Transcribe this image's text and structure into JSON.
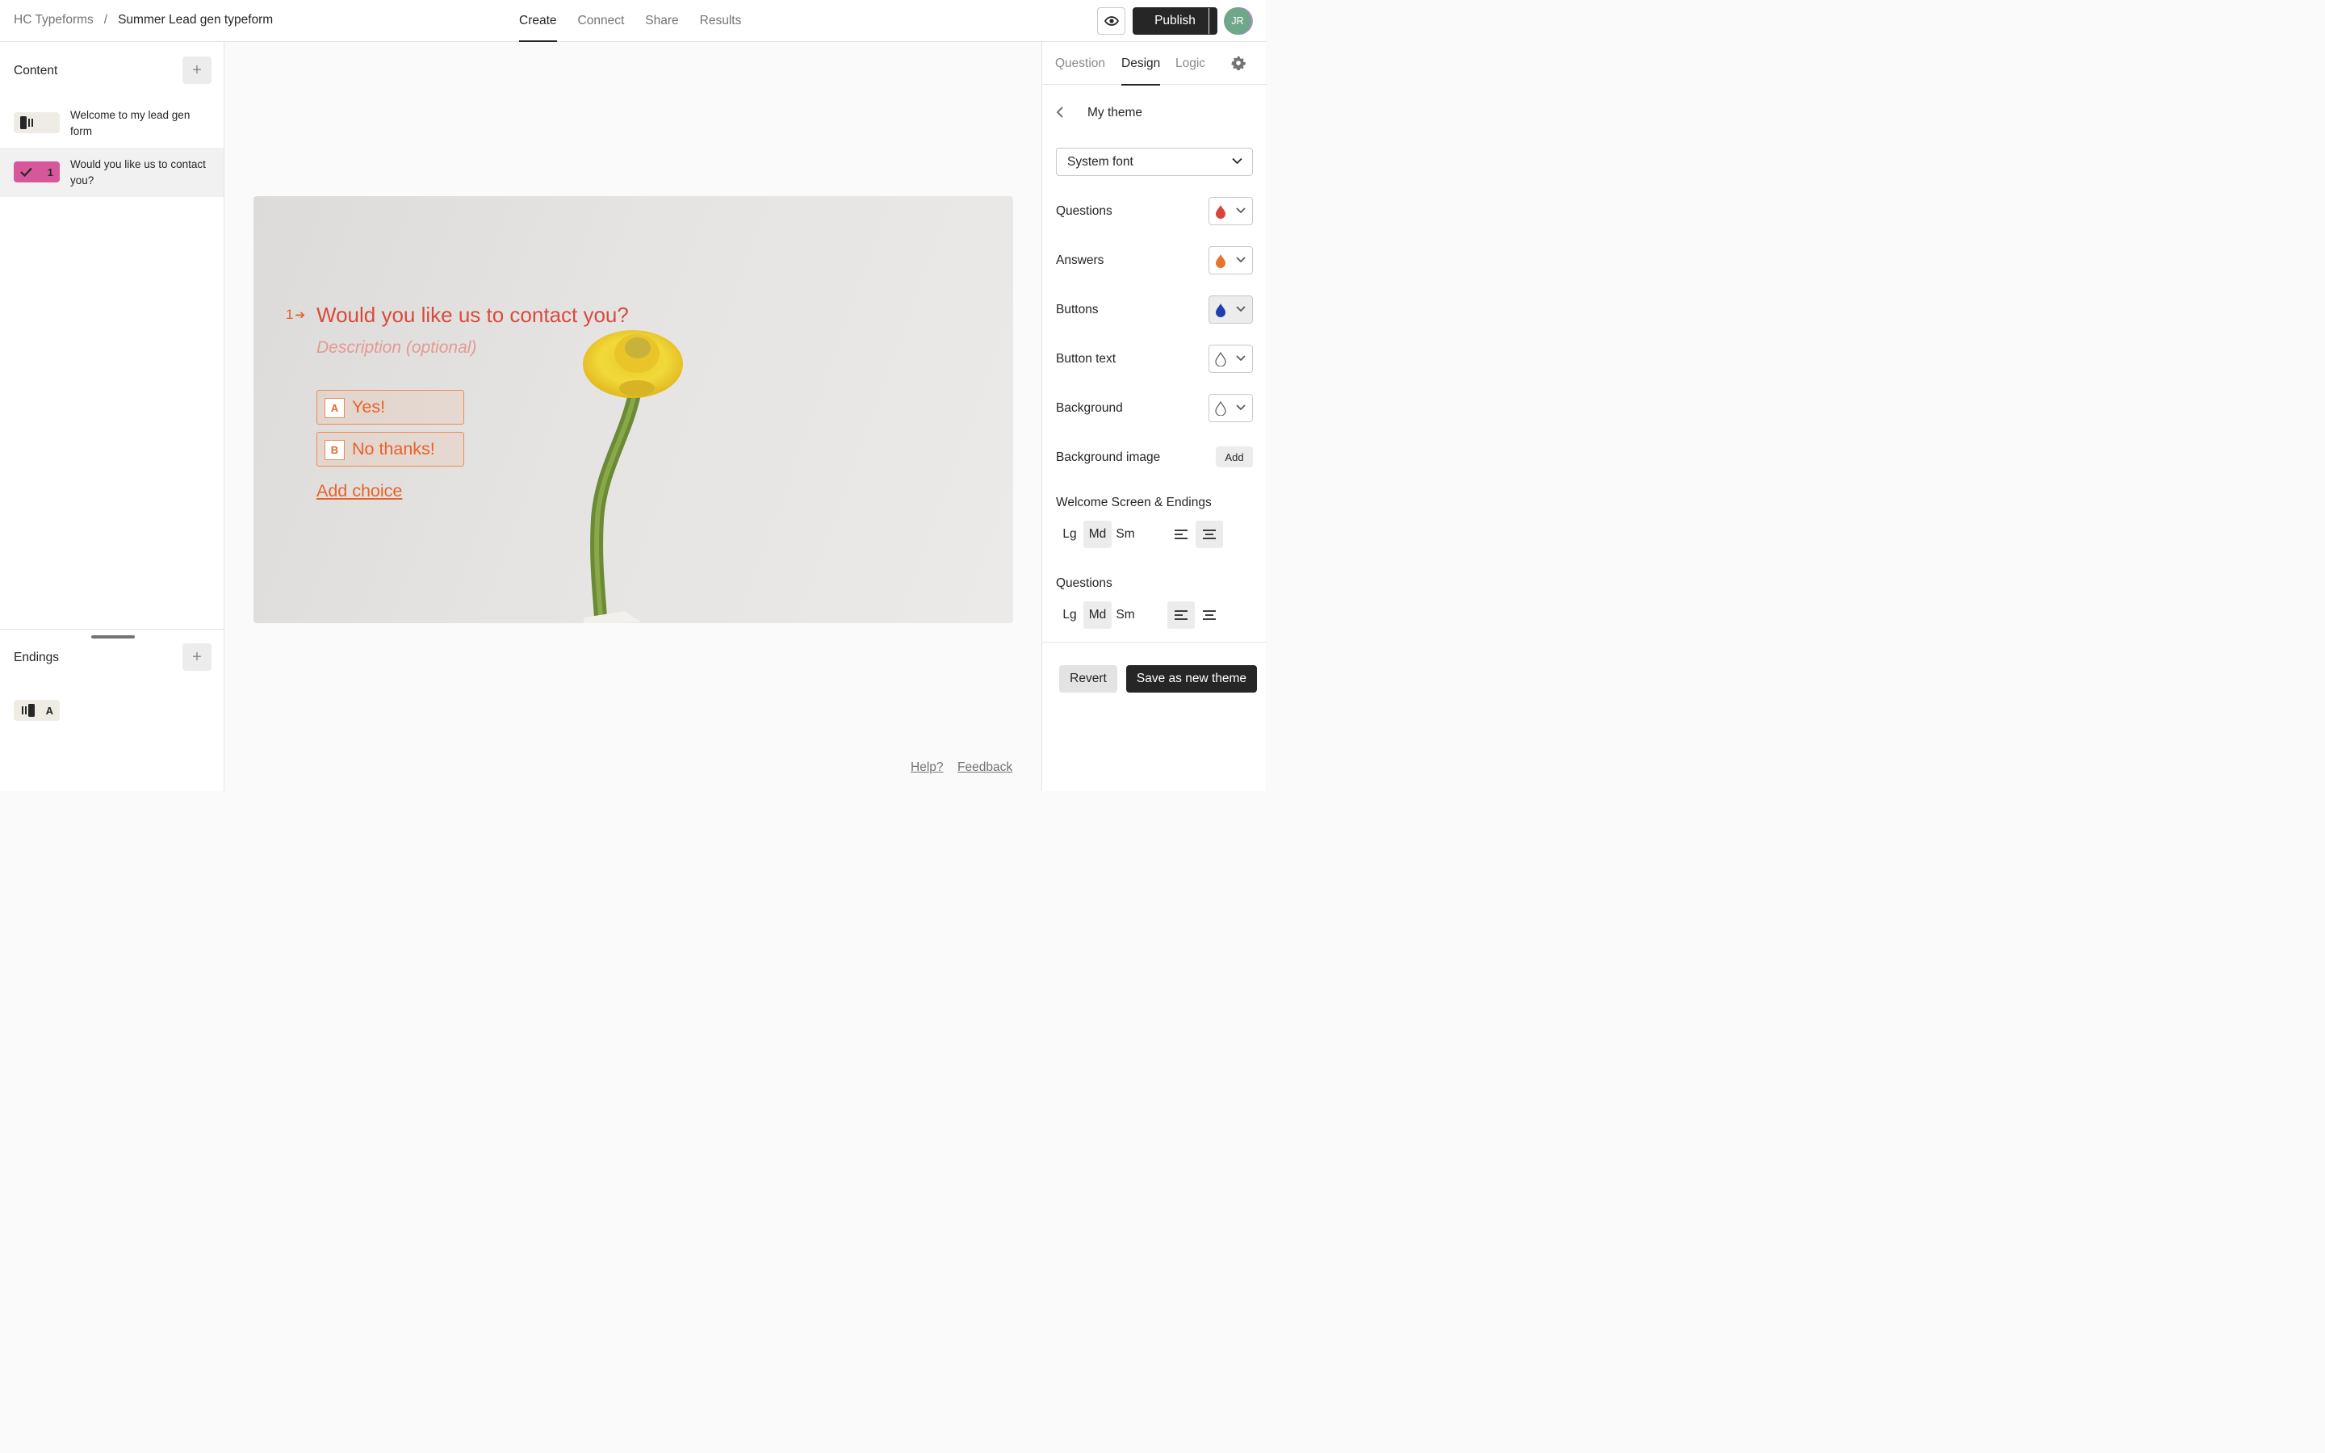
{
  "breadcrumb": {
    "workspace": "HC Typeforms",
    "separator": "/",
    "form": "Summer Lead gen typeform"
  },
  "main_tabs": [
    {
      "label": "Create",
      "active": true
    },
    {
      "label": "Connect",
      "active": false
    },
    {
      "label": "Share",
      "active": false
    },
    {
      "label": "Results",
      "active": false
    }
  ],
  "header": {
    "publish_label": "Publish",
    "preview_icon": "eye-icon",
    "avatar_initials": "JR"
  },
  "sidebar": {
    "content_heading": "Content",
    "items": [
      {
        "badge": "",
        "badge_icon": "welcome-screen-icon",
        "label": "Welcome to my lead gen form",
        "badge_color": "#efece6"
      },
      {
        "badge": "1",
        "badge_icon": "check-icon",
        "label": "Would you like us to contact you?",
        "badge_color": "#d6589b",
        "selected": true
      }
    ],
    "endings_heading": "Endings",
    "endings": [
      {
        "badge": "A",
        "badge_icon": "ending-screen-icon"
      }
    ]
  },
  "canvas": {
    "question_number": "1",
    "question_title": "Would you like us to contact you?",
    "description_placeholder": "Description (optional)",
    "choices": [
      {
        "key": "A",
        "label": "Yes!"
      },
      {
        "key": "B",
        "label": "No thanks!"
      }
    ],
    "add_choice_label": "Add choice",
    "background_image": "dandelion-flower-image"
  },
  "footer_links": {
    "help": "Help?",
    "feedback": "Feedback"
  },
  "right_panel": {
    "tabs": [
      {
        "label": "Question",
        "active": false
      },
      {
        "label": "Design",
        "active": true
      },
      {
        "label": "Logic",
        "active": false
      }
    ],
    "theme_name": "My theme",
    "font": "System font",
    "color_rows": [
      {
        "label": "Questions",
        "color": "#d8453c"
      },
      {
        "label": "Answers",
        "color": "#e8732c"
      },
      {
        "label": "Buttons",
        "color": "#1f3fae"
      },
      {
        "label": "Button text",
        "color": "#ffffff"
      },
      {
        "label": "Background",
        "color": "#ffffff"
      }
    ],
    "background_image_label": "Background image",
    "background_image_action": "Add",
    "welcome_section": {
      "label": "Welcome Screen & Endings",
      "sizes": [
        "Lg",
        "Md",
        "Sm"
      ],
      "selected_size": "Md",
      "alignment": "center"
    },
    "questions_section": {
      "label": "Questions",
      "sizes": [
        "Lg",
        "Md",
        "Sm"
      ],
      "selected_size": "Md",
      "alignment": "left"
    },
    "revert_label": "Revert",
    "save_label": "Save as new theme"
  },
  "colors": {
    "accent_dark": "#262627",
    "question_color": "#d94a3d",
    "answer_color": "#e8622a"
  }
}
